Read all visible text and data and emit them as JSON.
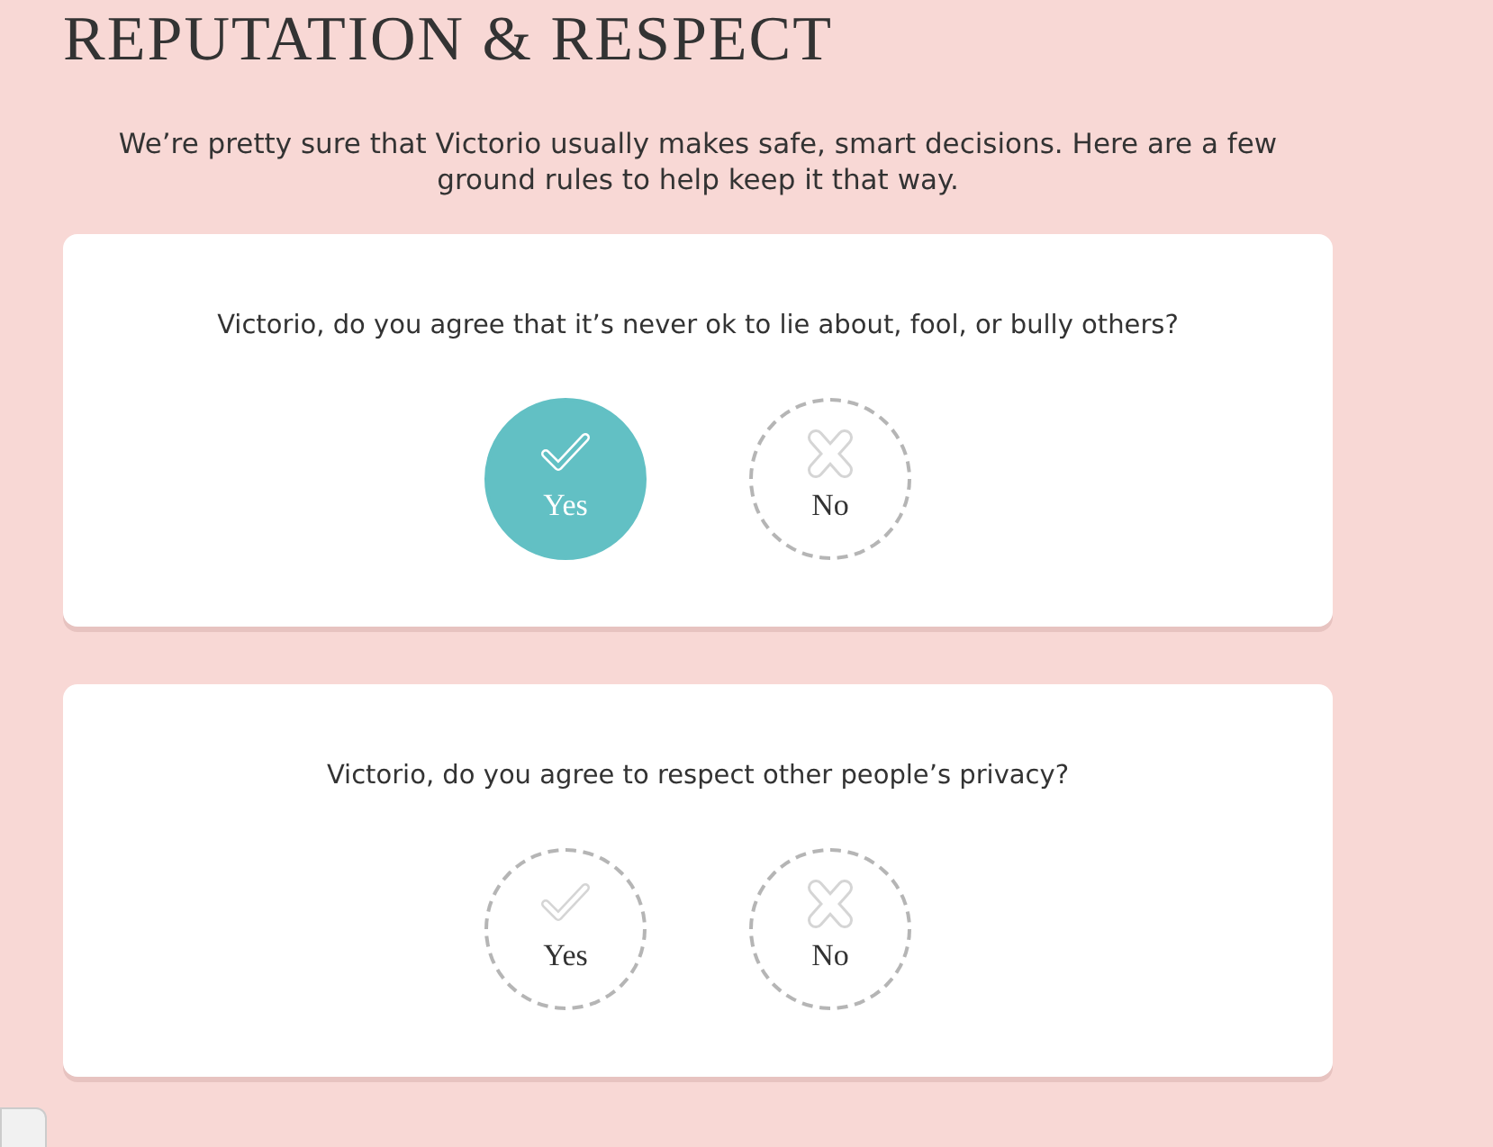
{
  "heading": "REPUTATION & RESPECT",
  "intro": "We’re pretty sure that Victorio usually makes safe, smart decisions. Here are a few ground rules to help keep it that way.",
  "questions": [
    {
      "text": "Victorio, do you agree that it’s never ok to lie about, fool, or bully others?",
      "options": [
        {
          "kind": "yes",
          "label": "Yes",
          "selected": true
        },
        {
          "kind": "no",
          "label": "No",
          "selected": false
        }
      ]
    },
    {
      "text": "Victorio, do you agree to respect other people’s privacy?",
      "options": [
        {
          "kind": "yes",
          "label": "Yes",
          "selected": false
        },
        {
          "kind": "no",
          "label": "No",
          "selected": false
        }
      ]
    }
  ]
}
